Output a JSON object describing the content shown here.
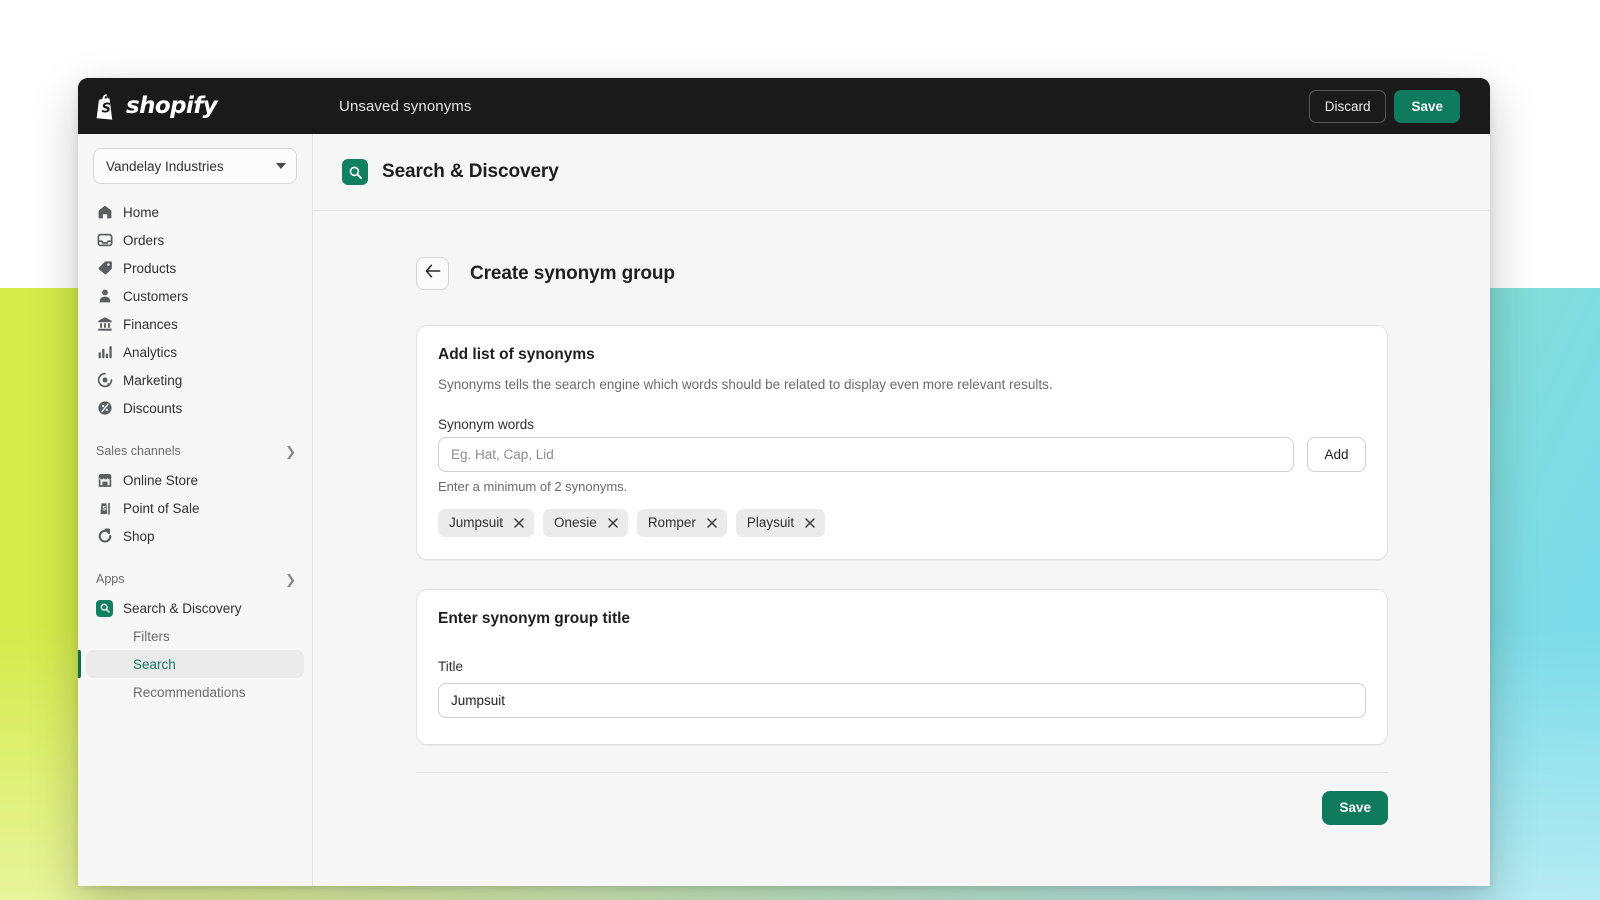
{
  "topbar": {
    "brand": "shopify",
    "brand_icon": "shopify-bag-icon",
    "title": "Unsaved synonyms",
    "discard_label": "Discard",
    "save_label": "Save"
  },
  "sidebar": {
    "store_switcher": {
      "name": "Vandelay Industries",
      "caret_icon": "chevron-down-icon"
    },
    "items": [
      {
        "label": "Home",
        "icon": "home-icon"
      },
      {
        "label": "Orders",
        "icon": "orders-inbox-icon"
      },
      {
        "label": "Products",
        "icon": "products-tag-icon"
      },
      {
        "label": "Customers",
        "icon": "customers-person-icon"
      },
      {
        "label": "Finances",
        "icon": "finances-bank-icon"
      },
      {
        "label": "Analytics",
        "icon": "analytics-bars-icon"
      },
      {
        "label": "Marketing",
        "icon": "marketing-target-icon"
      },
      {
        "label": "Discounts",
        "icon": "discounts-badge-icon"
      }
    ],
    "sections": [
      {
        "label": "Sales channels",
        "chevron_icon": "chevron-right-icon",
        "items": [
          {
            "label": "Online Store",
            "icon": "online-store-icon"
          },
          {
            "label": "Point of Sale",
            "icon": "point-of-sale-icon"
          },
          {
            "label": "Shop",
            "icon": "shop-icon"
          }
        ]
      },
      {
        "label": "Apps",
        "chevron_icon": "chevron-right-icon",
        "items": [
          {
            "label": "Search & Discovery",
            "icon": "search-discovery-app-icon"
          }
        ],
        "subitems": [
          {
            "label": "Filters",
            "active": false
          },
          {
            "label": "Search",
            "active": true
          },
          {
            "label": "Recommendations",
            "active": false
          }
        ]
      }
    ]
  },
  "app_header": {
    "icon": "search-discovery-app-icon",
    "title": "Search & Discovery"
  },
  "page": {
    "back_icon": "arrow-left-icon",
    "title": "Create synonym group",
    "synonyms_card": {
      "title": "Add list of synonyms",
      "description": "Synonyms tells the search engine which words should be related to display even more relevant results.",
      "field_label": "Synonym words",
      "input_value": "",
      "input_placeholder": "Eg. Hat, Cap, Lid",
      "add_label": "Add",
      "help_text": "Enter a minimum of 2 synonyms.",
      "tags": [
        {
          "label": "Jumpsuit",
          "remove_icon": "close-icon"
        },
        {
          "label": "Onesie",
          "remove_icon": "close-icon"
        },
        {
          "label": "Romper",
          "remove_icon": "close-icon"
        },
        {
          "label": "Playsuit",
          "remove_icon": "close-icon"
        }
      ]
    },
    "title_card": {
      "title": "Enter synonym group title",
      "field_label": "Title",
      "input_value": "Jumpsuit",
      "input_placeholder": ""
    },
    "save_label": "Save"
  },
  "colors": {
    "accent_green": "#0f7a5c",
    "topbar_dark": "#1a1a1a",
    "active_green": "#0b6e4f",
    "app_icon_green": "#118060"
  }
}
